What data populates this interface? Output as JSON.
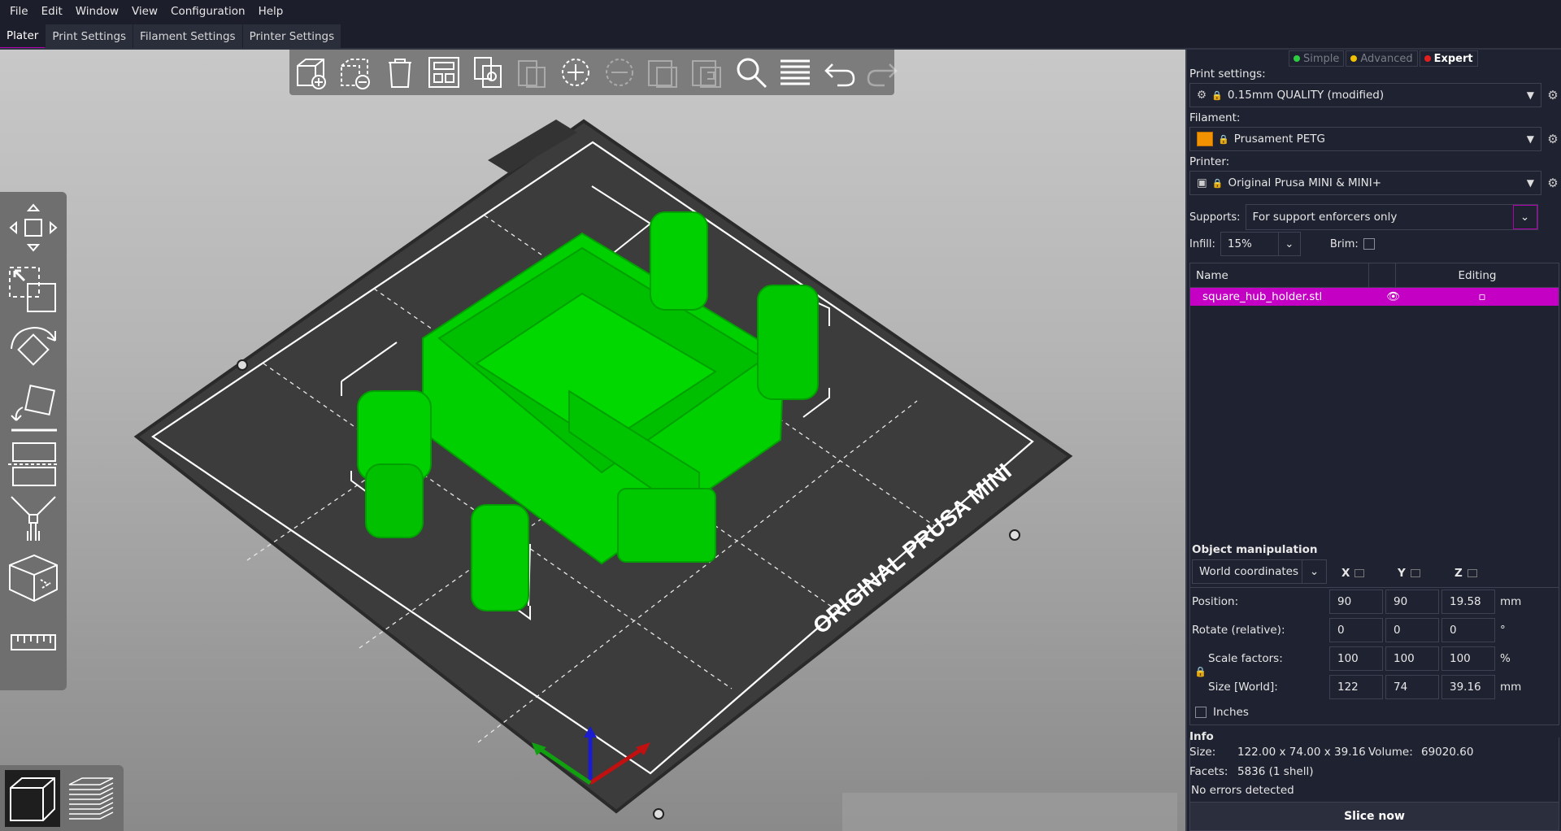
{
  "menu": [
    "File",
    "Edit",
    "Window",
    "View",
    "Configuration",
    "Help"
  ],
  "tabs": [
    "Plater",
    "Print Settings",
    "Filament Settings",
    "Printer Settings"
  ],
  "bed_label": "ORIGINAL PRUSA MINI",
  "modes": [
    {
      "label": "Simple",
      "color": "#2ecc40"
    },
    {
      "label": "Advanced",
      "color": "#f0c000"
    },
    {
      "label": "Expert",
      "color": "#e02020"
    }
  ],
  "print_settings": {
    "label": "Print settings:",
    "value": "0.15mm QUALITY (modified)"
  },
  "filament": {
    "label": "Filament:",
    "value": "Prusament PETG",
    "color": "#f39200"
  },
  "printer": {
    "label": "Printer:",
    "value": "Original Prusa MINI & MINI+"
  },
  "supports": {
    "label": "Supports:",
    "value": "For support enforcers only"
  },
  "infill": {
    "label": "Infill:",
    "value": "15%"
  },
  "brim": {
    "label": "Brim:"
  },
  "object_list": {
    "col_name": "Name",
    "col_editing": "Editing",
    "rows": [
      {
        "name": "square_hub_holder.stl"
      }
    ]
  },
  "manip": {
    "title": "Object manipulation",
    "coords": "World coordinates",
    "axes": [
      "X",
      "Y",
      "Z"
    ],
    "position": {
      "label": "Position:",
      "x": "90",
      "y": "90",
      "z": "19.58",
      "unit": "mm"
    },
    "rotate": {
      "label": "Rotate (relative):",
      "x": "0",
      "y": "0",
      "z": "0",
      "unit": "°"
    },
    "scale": {
      "label": "Scale factors:",
      "x": "100",
      "y": "100",
      "z": "100",
      "unit": "%"
    },
    "size": {
      "label": "Size [World]:",
      "x": "122",
      "y": "74",
      "z": "39.16",
      "unit": "mm"
    },
    "inches": "Inches"
  },
  "info": {
    "title": "Info",
    "size_label": "Size:",
    "size_value": "122.00 x 74.00 x 39.16",
    "volume_label": "Volume:",
    "volume_value": "69020.60",
    "facets_label": "Facets:",
    "facets_value": "5836 (1 shell)",
    "errors": "No errors detected"
  },
  "slice_button": "Slice now"
}
